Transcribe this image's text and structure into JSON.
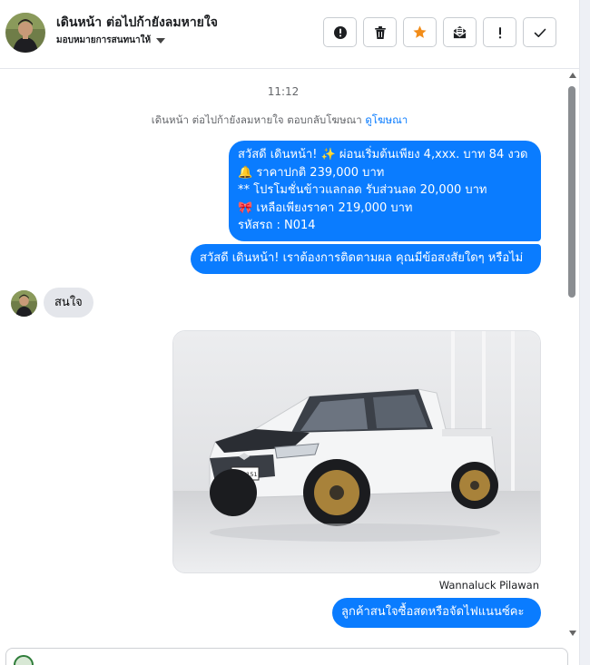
{
  "header": {
    "title": "เดินหน้า ต่อไปก้ายังลมหายใจ",
    "subtitle": "มอบหมายการสนทนาให้",
    "actions": [
      {
        "name": "report-button",
        "icon": "alert-circle-icon"
      },
      {
        "name": "delete-button",
        "icon": "trash-icon"
      },
      {
        "name": "star-button",
        "icon": "star-icon",
        "color": "#f28c18"
      },
      {
        "name": "mark-unread-button",
        "icon": "envelope-icon"
      },
      {
        "name": "important-button",
        "icon": "exclamation-icon"
      },
      {
        "name": "done-button",
        "icon": "check-icon"
      }
    ]
  },
  "chat": {
    "timestamp": "11:12",
    "notice_text": "เดินหน้า ต่อไปก้ายังลมหายใจ ตอบกลับโฆษณา",
    "notice_link": "ดูโฆษณา",
    "messages": {
      "promo_lines": [
        "สวัสดี เดินหน้า! ✨  ผ่อนเริ่มต้นเพียง 4,xxx. บาท 84 งวด",
        "🔔 ราคาปกติ 239,000 บาท",
        "** โปรโมชั่นข้าวแลกลด รับส่วนลด 20,000 บาท",
        "🎀  เหลือเพียงราคา 219,000 บาท",
        " รหัสรถ : N014"
      ],
      "followup": "สวัสดี เดินหน้า! เราต้องการติดตามผล คุณมีข้อสงสัยใดๆ หรือไม่",
      "customer_reply": "สนใจ",
      "sender_name": "Wannaluck Pilawan",
      "last_message": "ลูกค้าสนใจซื้อสดหรือจัดไฟแนนซ์คะ"
    },
    "photo": {
      "plate": "ษพ 8151"
    }
  },
  "colors": {
    "outgoing_bubble": "#0a7cff",
    "incoming_bubble": "#e4e6eb",
    "star": "#f28c18"
  }
}
